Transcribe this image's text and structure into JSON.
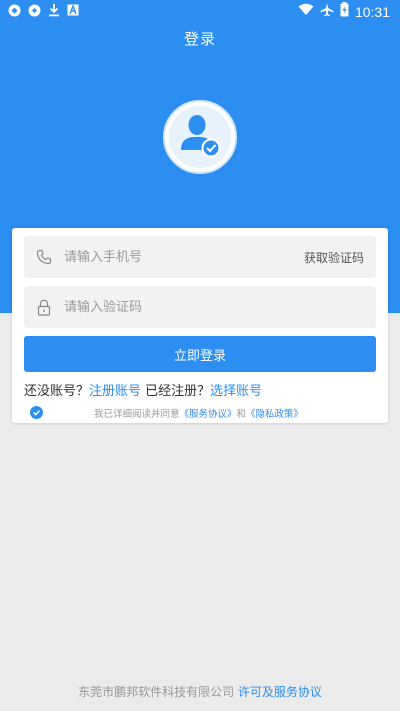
{
  "status_bar": {
    "time": "10:31",
    "left_icons": [
      "app-icon-1",
      "app-icon-2",
      "download-icon",
      "font-icon"
    ],
    "right_icons": [
      "wifi-icon",
      "airplane-icon",
      "battery-icon"
    ]
  },
  "header": {
    "title": "登录",
    "background_color": "#2b8ef0",
    "avatar_icon": "user-verified-icon"
  },
  "form": {
    "phone_placeholder": "请输入手机号",
    "phone_value": "",
    "get_code_label": "获取验证码",
    "code_placeholder": "请输入验证码",
    "code_value": "",
    "login_label": "立即登录"
  },
  "account": {
    "no_account_text": "还没账号？",
    "register_link": "注册账号",
    "registered_text": " 已经注册？",
    "select_link": "选择账号"
  },
  "agreement": {
    "checked": true,
    "prefix": "我已详细阅读并同意",
    "service_link": "《服务协议》",
    "and_text": "和",
    "privacy_link": "《隐私政策》"
  },
  "footer": {
    "company": "东莞市鹏邦软件科技有限公司",
    "license_link": "许可及服务协议"
  }
}
